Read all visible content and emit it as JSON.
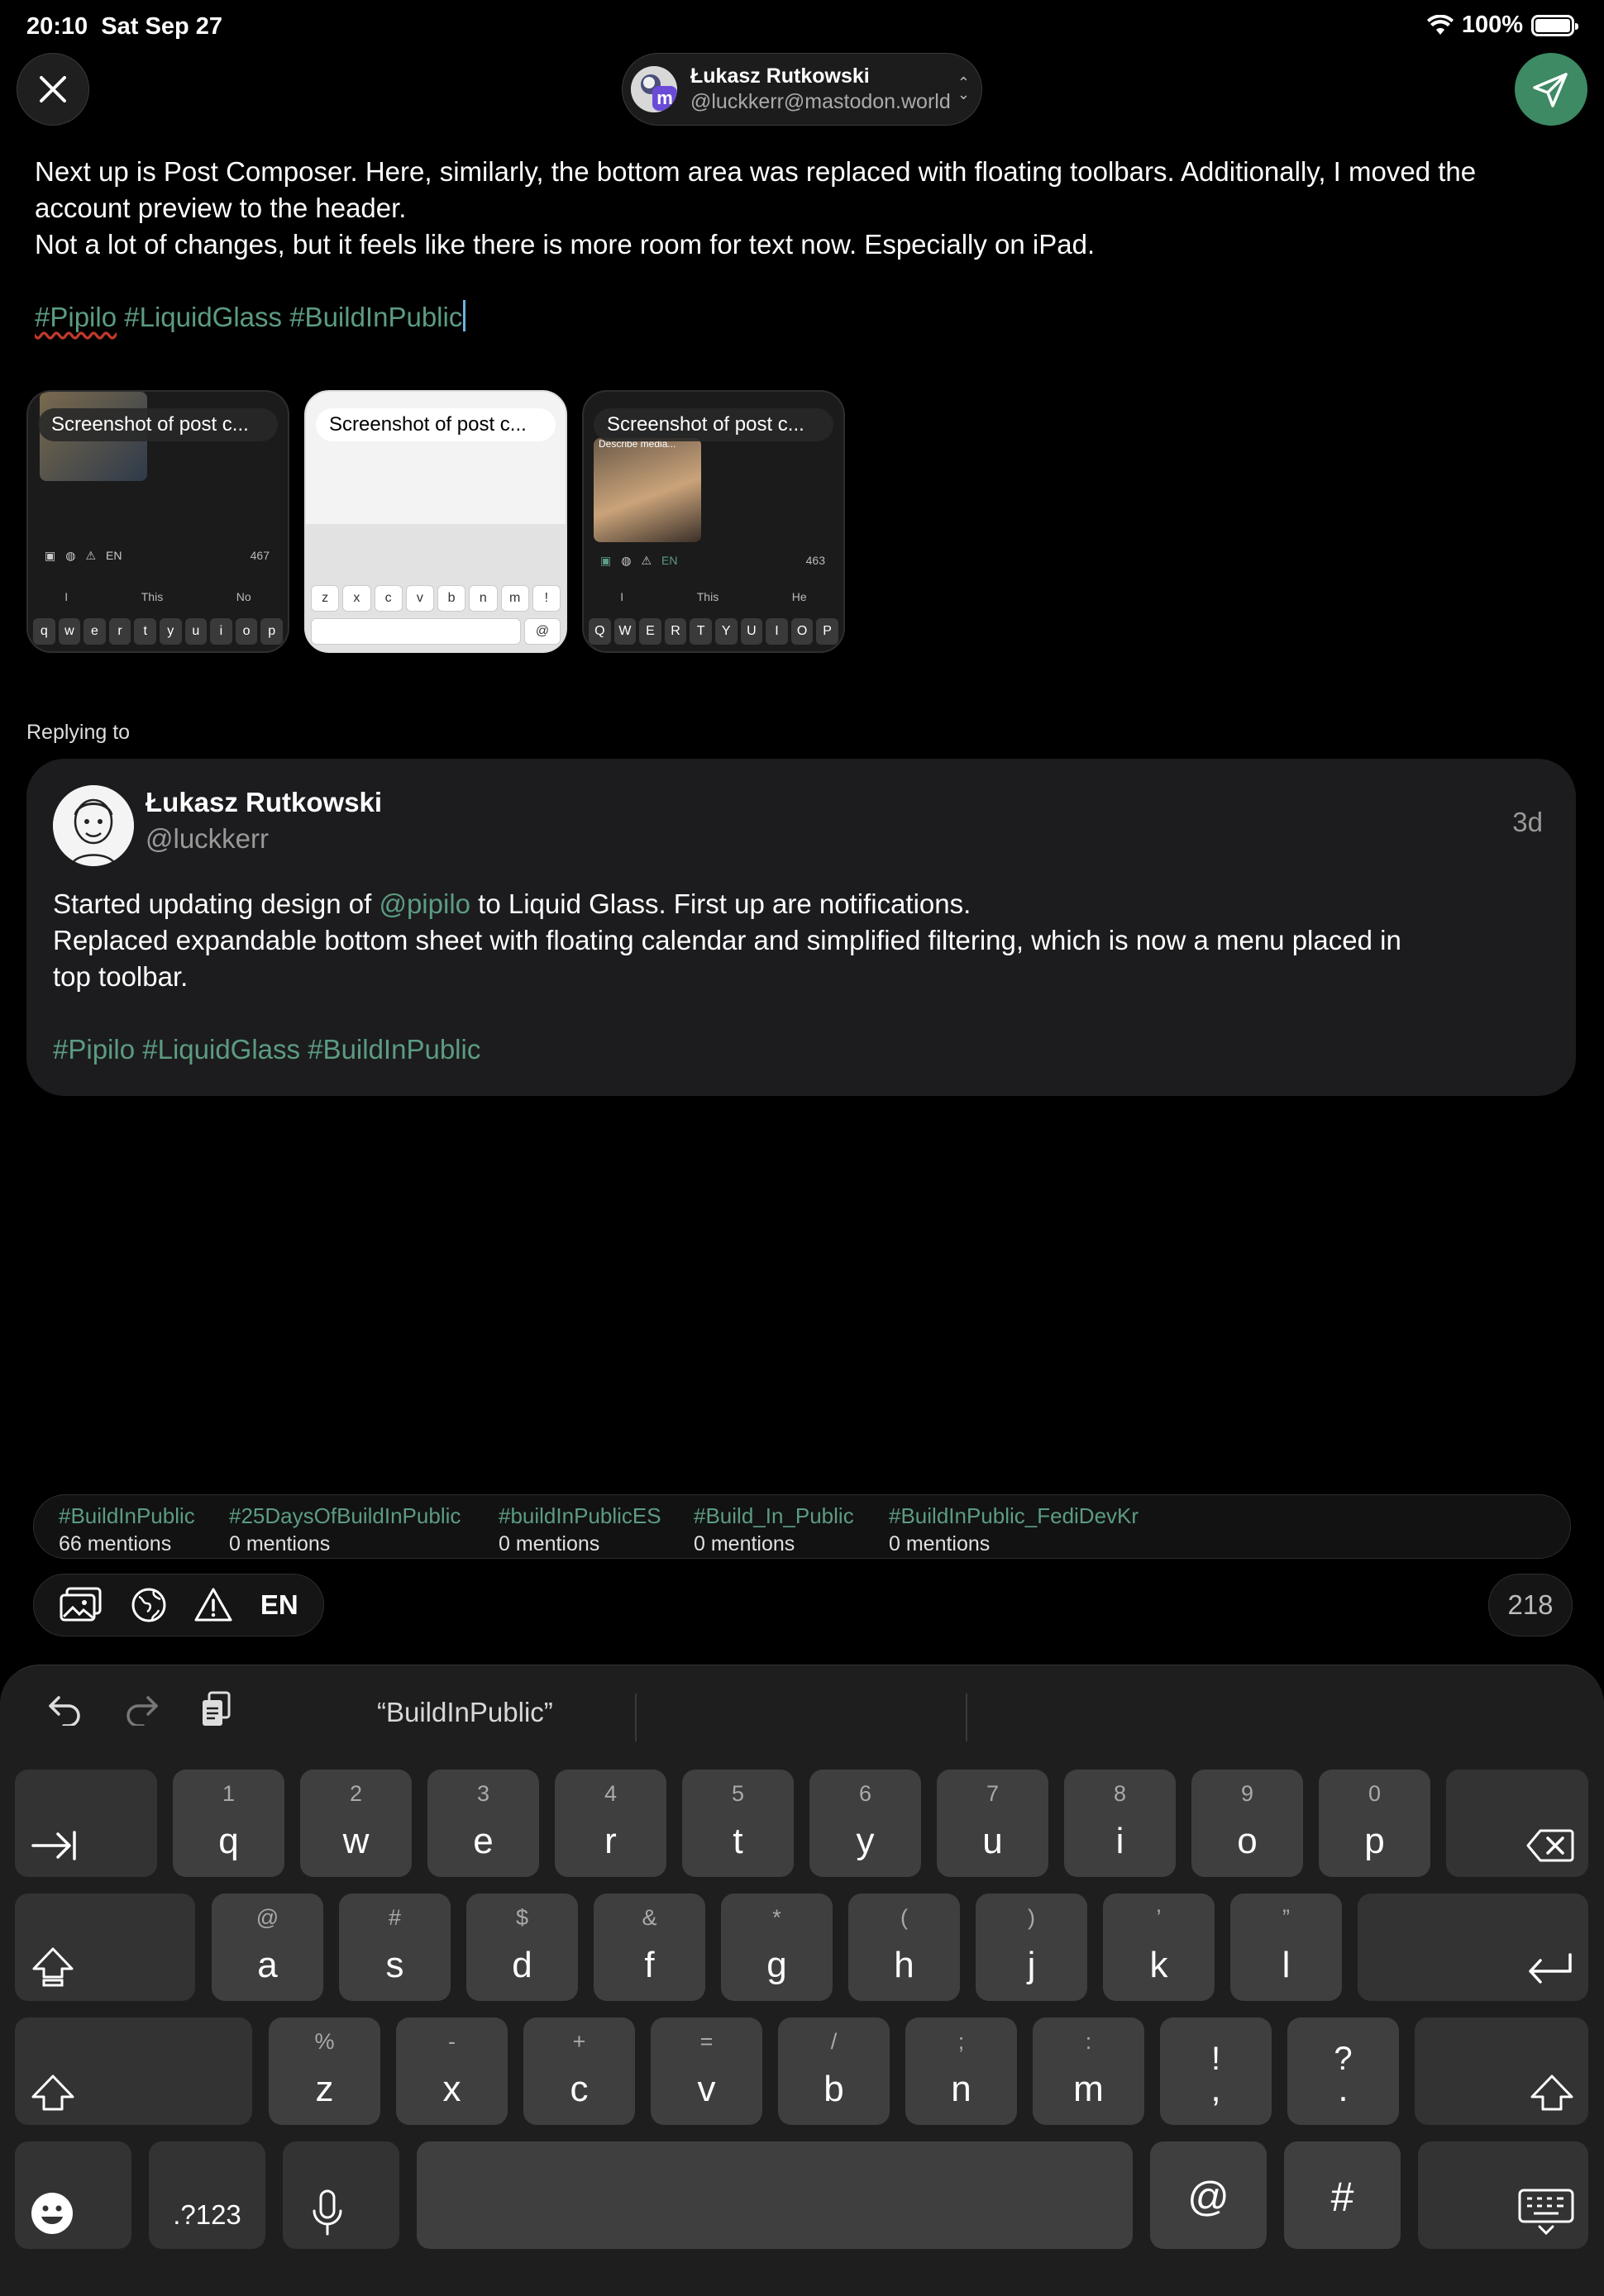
{
  "status": {
    "time": "20:10",
    "date": "Sat Sep 27",
    "battery": "100%"
  },
  "account": {
    "name": "Łukasz Rutkowski",
    "handle": "@luckkerr@mastodon.world",
    "badge": "m"
  },
  "composer": {
    "line1": "Next up is Post Composer. Here, similarly, the bottom area was replaced with floating toolbars. Additionally, I moved the",
    "line2": "account preview to the header.",
    "line3": "Not a lot of changes, but it feels like there is more room for text now. Especially on iPad.",
    "tags": [
      "#Pipilo",
      "#LiquidGlass",
      "#BuildInPublic"
    ]
  },
  "attachments": [
    {
      "label": "Screenshot of post c...",
      "count": "467",
      "sugg": [
        "I",
        "This",
        "No"
      ],
      "keys": [
        "q",
        "w",
        "e",
        "r",
        "t",
        "y",
        "u",
        "i",
        "o",
        "p"
      ]
    },
    {
      "label": "Screenshot of post c...",
      "keys": [
        "z",
        "x",
        "c",
        "v",
        "b",
        "n",
        "m",
        "!",
        "@"
      ]
    },
    {
      "label": "Screenshot of post c...",
      "count": "463",
      "sugg": [
        "I",
        "This",
        "He"
      ],
      "keys": [
        "Q",
        "W",
        "E",
        "R",
        "T",
        "Y",
        "U",
        "I",
        "O",
        "P"
      ],
      "describe": "Describe media..."
    }
  ],
  "mini_lang": "EN",
  "reply": {
    "heading": "Replying to",
    "name": "Łukasz Rutkowski",
    "handle": "@luckkerr",
    "time": "3d",
    "text1a": "Started updating design of ",
    "mention": "@pipilo",
    "text1b": " to Liquid Glass. First up are notifications.",
    "text2": "Replaced expandable bottom sheet with floating calendar and simplified filtering, which is now a menu placed in",
    "text3": "top toolbar.",
    "tags": [
      "#Pipilo",
      "#LiquidGlass",
      "#BuildInPublic"
    ]
  },
  "hashtag_suggestions": [
    {
      "tag": "#BuildInPublic",
      "count": "66 mentions"
    },
    {
      "tag": "#25DaysOfBuildInPublic",
      "count": "0 mentions"
    },
    {
      "tag": "#buildInPublicES",
      "count": "0 mentions"
    },
    {
      "tag": "#Build_In_Public",
      "count": "0 mentions"
    },
    {
      "tag": "#BuildInPublic_FediDevKr",
      "count": "0 mentions"
    }
  ],
  "toolbar": {
    "language": "EN",
    "remaining": "218",
    "icons": [
      "media-icon",
      "globe-icon",
      "warning-icon"
    ]
  },
  "keyboard": {
    "suggestion": "“BuildInPublic”",
    "row1": [
      {
        "s": "1",
        "m": "q"
      },
      {
        "s": "2",
        "m": "w"
      },
      {
        "s": "3",
        "m": "e"
      },
      {
        "s": "4",
        "m": "r"
      },
      {
        "s": "5",
        "m": "t"
      },
      {
        "s": "6",
        "m": "y"
      },
      {
        "s": "7",
        "m": "u"
      },
      {
        "s": "8",
        "m": "i"
      },
      {
        "s": "9",
        "m": "o"
      },
      {
        "s": "0",
        "m": "p"
      }
    ],
    "row2": [
      {
        "s": "@",
        "m": "a"
      },
      {
        "s": "#",
        "m": "s"
      },
      {
        "s": "$",
        "m": "d"
      },
      {
        "s": "&",
        "m": "f"
      },
      {
        "s": "*",
        "m": "g"
      },
      {
        "s": "(",
        "m": "h"
      },
      {
        "s": ")",
        "m": "j"
      },
      {
        "s": "’",
        "m": "k"
      },
      {
        "s": "”",
        "m": "l"
      }
    ],
    "row3": [
      {
        "s": "%",
        "m": "z"
      },
      {
        "s": "-",
        "m": "x"
      },
      {
        "s": "+",
        "m": "c"
      },
      {
        "s": "=",
        "m": "v"
      },
      {
        "s": "/",
        "m": "b"
      },
      {
        "s": ";",
        "m": "n"
      },
      {
        "s": ":",
        "m": "m"
      }
    ],
    "row3_punct": [
      {
        "a": "!",
        "b": ","
      },
      {
        "a": "?",
        "b": "."
      }
    ],
    "numbers_label": ".?123",
    "at_key": "@",
    "hash_key": "#"
  },
  "colors": {
    "accent": "#3d8a64",
    "tag": "#5c9c82",
    "background": "#000000",
    "card": "#1c1c1e",
    "key": "#3f3f3f"
  }
}
